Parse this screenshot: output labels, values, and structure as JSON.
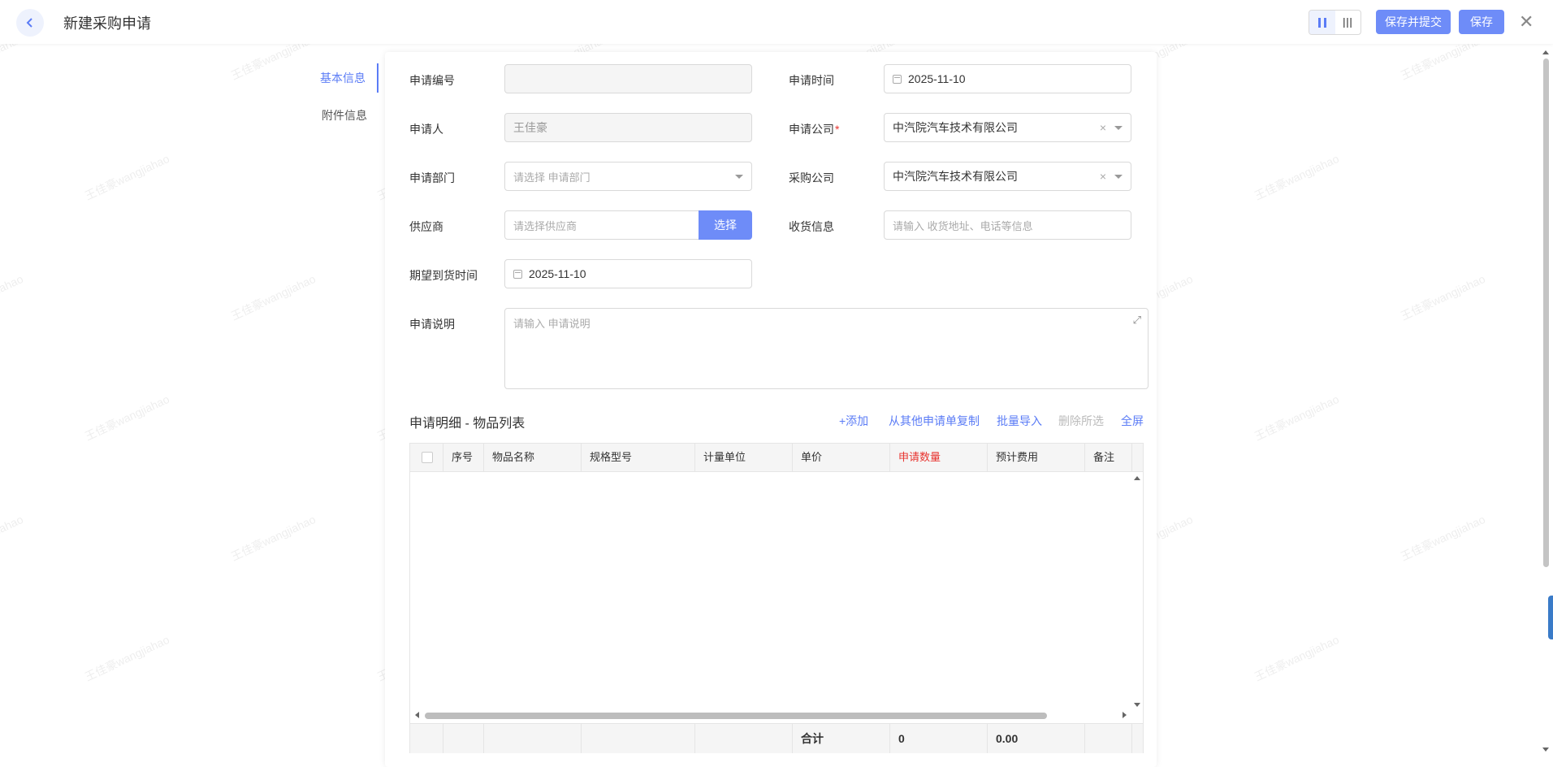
{
  "header": {
    "title": "新建采购申请",
    "save_submit_label": "保存并提交",
    "save_label": "保存"
  },
  "anchor_nav": [
    "基本信息",
    "附件信息"
  ],
  "form": {
    "apply_no": {
      "label": "申请编号",
      "value": ""
    },
    "apply_time": {
      "label": "申请时间",
      "value": "2025-11-10"
    },
    "applicant": {
      "label": "申请人",
      "value": "王佳豪"
    },
    "apply_company": {
      "label": "申请公司",
      "value": "中汽院汽车技术有限公司"
    },
    "apply_dept": {
      "label": "申请部门",
      "placeholder": "请选择 申请部门"
    },
    "purchase_company": {
      "label": "采购公司",
      "value": "中汽院汽车技术有限公司"
    },
    "supplier": {
      "label": "供应商",
      "placeholder": "请选择供应商",
      "button": "选择"
    },
    "receiving": {
      "label": "收货信息",
      "placeholder": "请输入 收货地址、电话等信息"
    },
    "expected_date": {
      "label": "期望到货时间",
      "value": "2025-11-10"
    },
    "description": {
      "label": "申请说明",
      "placeholder": "请输入 申请说明"
    }
  },
  "detail": {
    "title": "申请明细 - 物品列表",
    "actions": {
      "add": "+添加",
      "copy": "从其他申请单复制",
      "import": "批量导入",
      "delete": "删除所选",
      "fullscreen": "全屏"
    },
    "columns": [
      "序号",
      "物品名称",
      "规格型号",
      "计量单位",
      "单价",
      "申请数量",
      "预计费用",
      "备注"
    ],
    "footer": {
      "total_label": "合计",
      "qty_total": "0",
      "cost_total": "0.00"
    }
  },
  "watermark": "王佳豪wangjiahao",
  "colors": {
    "primary": "#6e8cf8",
    "required": "#e8342f"
  }
}
